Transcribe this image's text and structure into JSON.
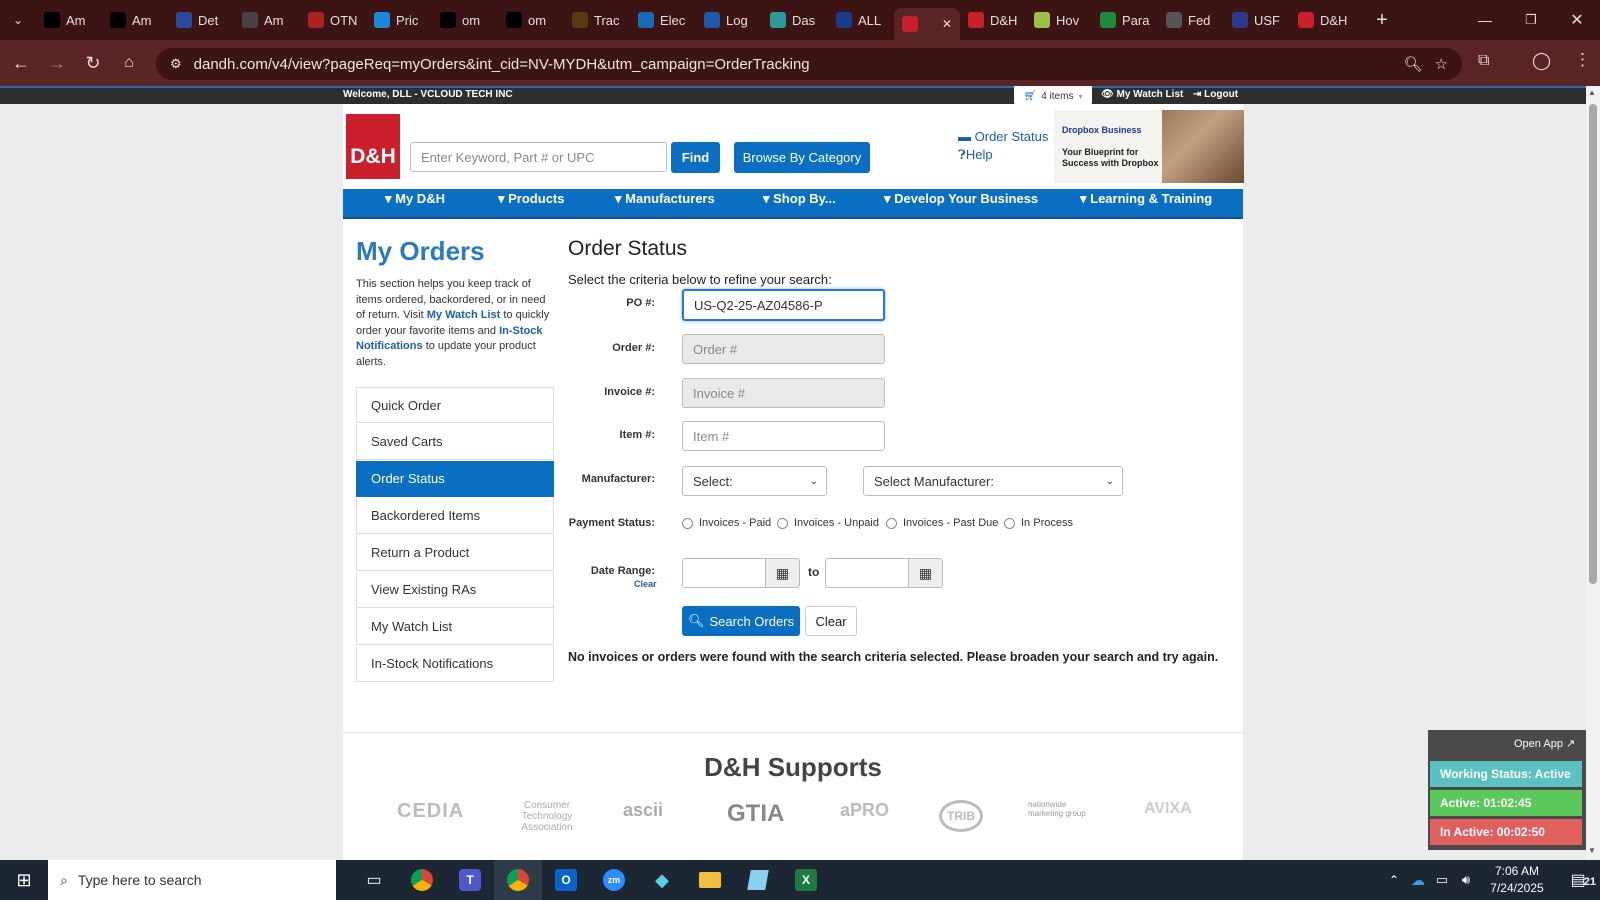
{
  "browser": {
    "tabs": [
      {
        "label": "Am",
        "icon": "amazon-icon",
        "color": "#000"
      },
      {
        "label": "Am",
        "icon": "amazon-icon",
        "color": "#000"
      },
      {
        "label": "Det",
        "icon": "flag-icon",
        "color": "#2a4aa0"
      },
      {
        "label": "Am",
        "icon": "amazon-a-icon",
        "color": "#444"
      },
      {
        "label": "OTN",
        "icon": "otn-icon",
        "color": "#a22"
      },
      {
        "label": "Pric",
        "icon": "dollar-icon",
        "color": "#1a8ad8"
      },
      {
        "label": "om",
        "icon": "triangle-icon",
        "color": "#000"
      },
      {
        "label": "om",
        "icon": "triangle-icon",
        "color": "#000"
      },
      {
        "label": "Trac",
        "icon": "ups-icon",
        "color": "#5a3a12"
      },
      {
        "label": "Elec",
        "icon": "ec-icon",
        "color": "#1a6ab8"
      },
      {
        "label": "Log",
        "icon": "g-icon",
        "color": "#1a5aa8"
      },
      {
        "label": "Das",
        "icon": "compass-icon",
        "color": "#2a9a9a"
      },
      {
        "label": "ALL",
        "icon": "seventeen-icon",
        "color": "#1a3a8a"
      },
      {
        "label": "",
        "icon": "dh-icon",
        "color": "#cc1f2d",
        "active": true
      },
      {
        "label": "D&H",
        "icon": "dh-icon",
        "color": "#cc1f2d"
      },
      {
        "label": "Hov",
        "icon": "circle-icon",
        "color": "#9ac04a"
      },
      {
        "label": "Para",
        "icon": "sheets-icon",
        "color": "#1e8a3a"
      },
      {
        "label": "Fed",
        "icon": "chatgpt-icon",
        "color": "#555"
      },
      {
        "label": "USF",
        "icon": "envelope-icon",
        "color": "#2a3a8a"
      },
      {
        "label": "D&H",
        "icon": "dh-icon",
        "color": "#cc1f2d"
      }
    ],
    "url": "dandh.com/v4/view?pageReq=myOrders&int_cid=NV-MYDH&utm_campaign=OrderTracking"
  },
  "top_strip": {
    "welcome": "Welcome, DLL - VCLOUD TECH INC",
    "cart": "4 items",
    "watch_list": "My Watch List",
    "logout": "Logout"
  },
  "header": {
    "logo": "D&H",
    "search_placeholder": "Enter Keyword, Part # or UPC",
    "find": "Find",
    "browse": "Browse By Category",
    "order_status": "Order Status",
    "help": "Help",
    "ad_brand": "Dropbox Business",
    "ad_text": "Your Blueprint for Success with Dropbox"
  },
  "nav": [
    "My D&H",
    "Products",
    "Manufacturers",
    "Shop By...",
    "Develop Your Business",
    "Learning & Training"
  ],
  "sidebar": {
    "title": "My Orders",
    "desc_1": "This section helps you keep track of items ordered, backordered, or in need of return. Visit",
    "desc_link1": "My Watch List",
    "desc_2": "to quickly order your favorite items and",
    "desc_link2": "In-Stock Notifications",
    "desc_3": "to update your product alerts.",
    "items": [
      "Quick Order",
      "Saved Carts",
      "Order Status",
      "Backordered Items",
      "Return a Product",
      "View Existing RAs",
      "My Watch List",
      "In-Stock Notifications"
    ]
  },
  "form": {
    "heading": "Order Status",
    "instructions": "Select the criteria below to refine your search:",
    "po_label": "PO #:",
    "po_value": "US-Q2-25-AZ04586-P",
    "order_label": "Order #:",
    "order_placeholder": "Order #",
    "invoice_label": "Invoice #:",
    "invoice_placeholder": "Invoice #",
    "item_label": "Item #:",
    "item_placeholder": "Item #",
    "manufacturer_label": "Manufacturer:",
    "manufacturer_select": "Select:",
    "manufacturer_select2": "Select Manufacturer:",
    "payment_label": "Payment Status:",
    "payment_options": [
      "Invoices - Paid",
      "Invoices - Unpaid",
      "Invoices - Past Due",
      "In Process"
    ],
    "date_label": "Date Range:",
    "date_clear": "Clear",
    "to": "to",
    "search_button": "Search Orders",
    "clear_button": "Clear",
    "no_results": "No invoices or orders were found with the search criteria selected. Please broaden your search and try again."
  },
  "supports": {
    "title": "D&H Supports",
    "logos": [
      "CEDIA",
      "Consumer Technology Association",
      "ascii",
      "GTIA",
      "aPRO",
      "TRIB",
      "nationwide marketing group",
      "AVIXA"
    ]
  },
  "widget": {
    "open_app": "Open App ↗",
    "working": "Working Status: Active",
    "active": "Active: 01:02:45",
    "inactive": "In Active: 00:02:50"
  },
  "taskbar": {
    "search_placeholder": "Type here to search",
    "time": "7:06 AM",
    "date": "7/24/2025",
    "notifications": "21"
  }
}
